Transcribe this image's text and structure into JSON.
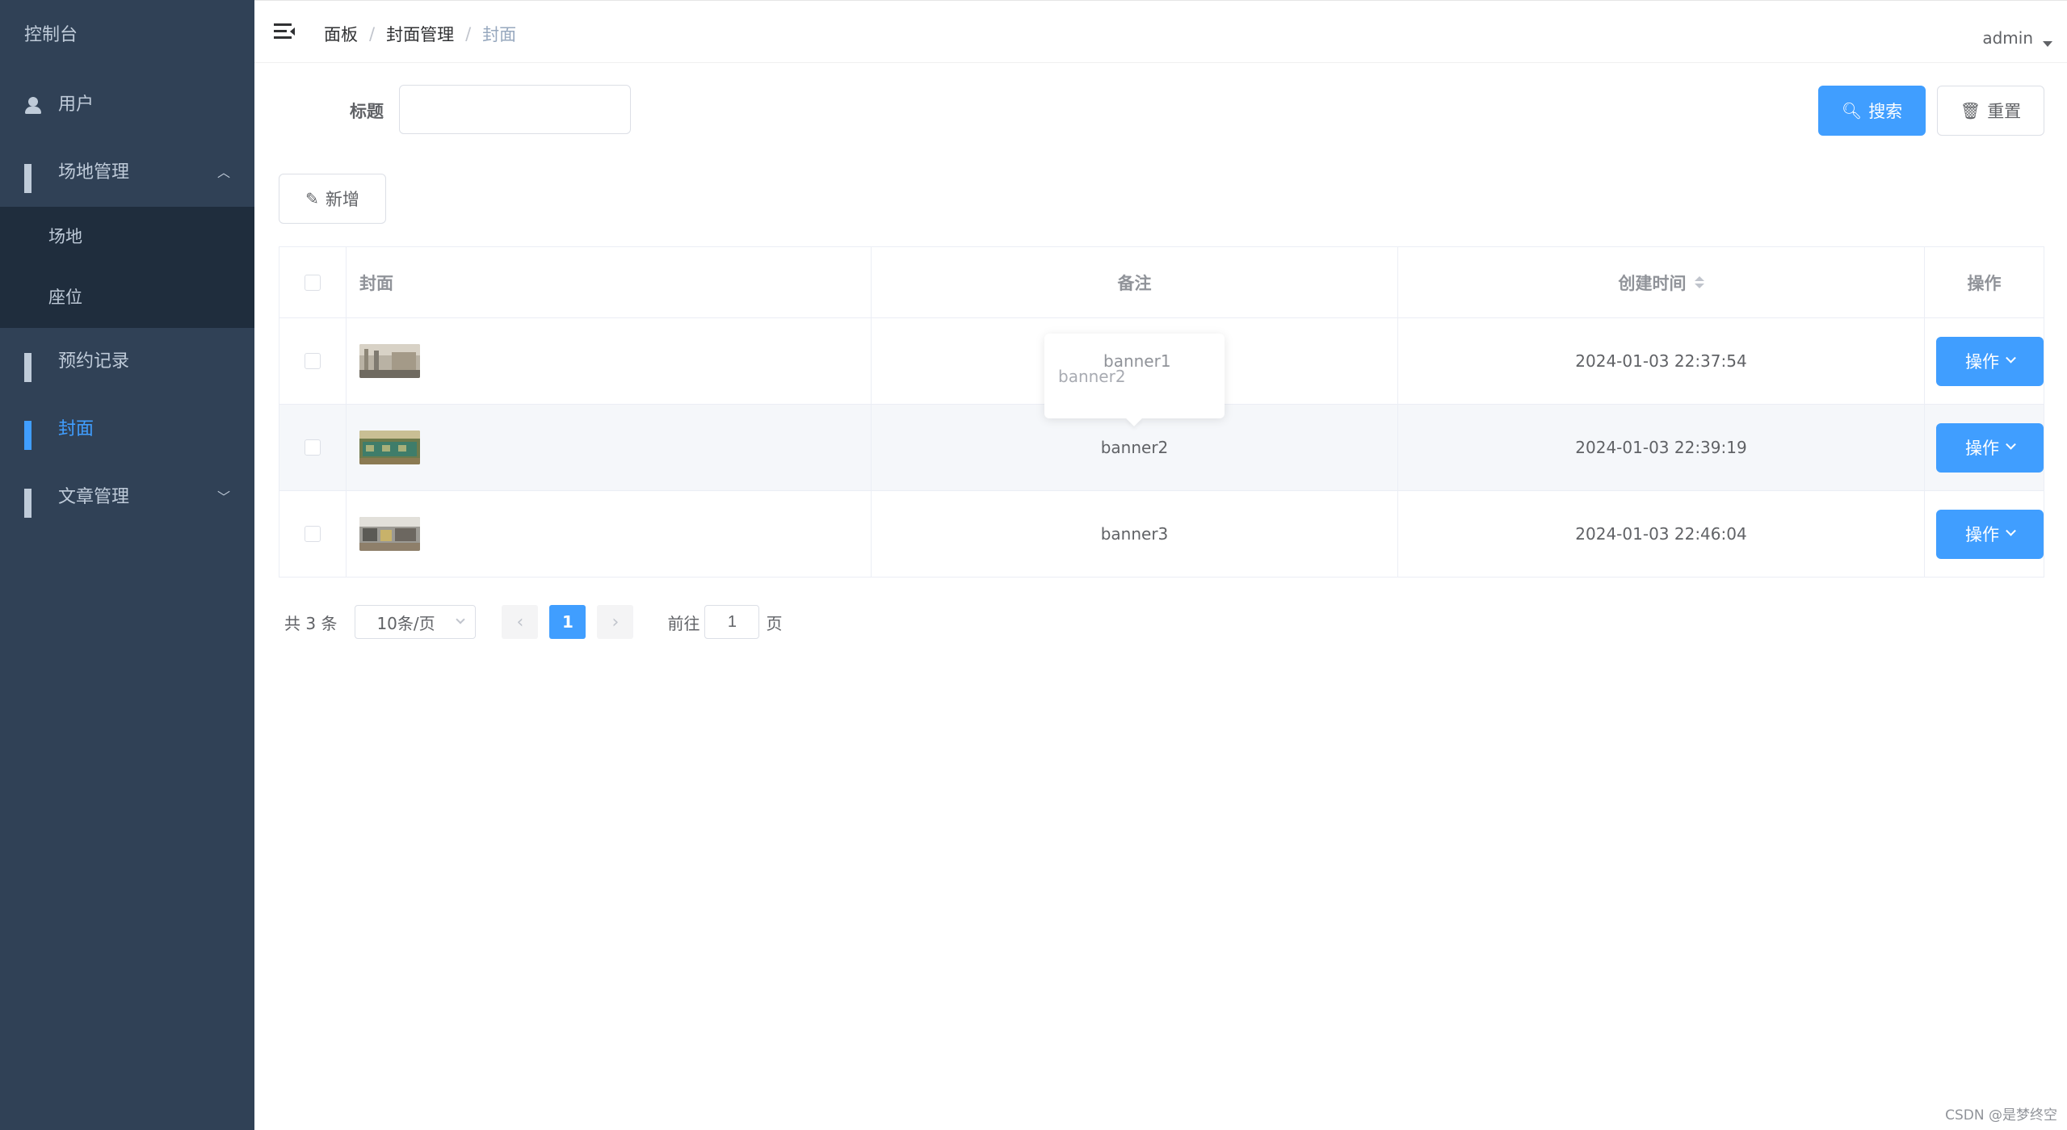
{
  "sidebar": {
    "title": "控制台",
    "items": [
      {
        "label": "用户",
        "icon": "user-icon"
      },
      {
        "label": "场地管理",
        "icon": "grid-icon",
        "arrow": "up"
      },
      {
        "label": "场地"
      },
      {
        "label": "座位"
      },
      {
        "label": "预约记录",
        "icon": "grid-icon"
      },
      {
        "label": "封面",
        "icon": "grid-icon",
        "active": true
      },
      {
        "label": "文章管理",
        "icon": "grid-icon",
        "arrow": "down"
      }
    ]
  },
  "header": {
    "breadcrumb": [
      "面板",
      "封面管理",
      "封面"
    ],
    "user": "admin"
  },
  "search": {
    "title_label": "标题",
    "title_value": "",
    "search_label": "搜索",
    "reset_label": "重置",
    "add_label": "新增"
  },
  "table": {
    "columns": [
      "封面",
      "备注",
      "创建时间",
      "操作"
    ],
    "rows": [
      {
        "remark": "banner1",
        "created": "2024-01-03 22:37:54",
        "op": "操作"
      },
      {
        "remark": "banner2",
        "created": "2024-01-03 22:39:19",
        "op": "操作"
      },
      {
        "remark": "banner3",
        "created": "2024-01-03 22:46:04",
        "op": "操作"
      }
    ]
  },
  "tooltip": {
    "line1": "banner1",
    "line2": "banner2"
  },
  "pagination": {
    "total": "共 3 条",
    "page_size": "10条/页",
    "current": "1",
    "goto_label": "前往",
    "goto_value": "1",
    "page_suffix": "页"
  },
  "watermark": "CSDN @是梦终空",
  "colors": {
    "sidebar_bg": "#304156",
    "sidebar_sub_bg": "#1f2d3d",
    "primary": "#409eff"
  }
}
